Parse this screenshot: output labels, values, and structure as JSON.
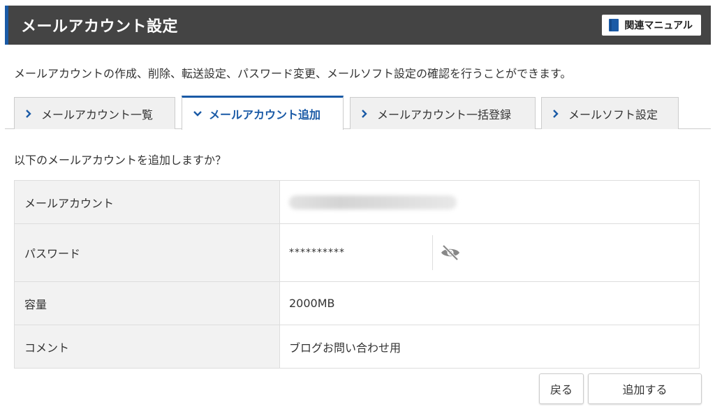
{
  "header": {
    "title": "メールアカウント設定",
    "manual_label": "関連マニュアル",
    "accent_color": "#1a5aa6",
    "background_color": "#444444"
  },
  "description": "メールアカウントの作成、削除、転送設定、パスワード変更、メールソフト設定の確認を行うことができます。",
  "tabs": [
    {
      "label": "メールアカウント一覧",
      "active": false
    },
    {
      "label": "メールアカウント追加",
      "active": true
    },
    {
      "label": "メールアカウント一括登録",
      "active": false
    },
    {
      "label": "メールソフト設定",
      "active": false
    }
  ],
  "confirm_text": "以下のメールアカウントを追加しますか？",
  "details": {
    "account_label": "メールアカウント",
    "account_value": "",
    "password_label": "パスワード",
    "password_value": "**********",
    "password_toggle_icon": "eye-slash-icon",
    "capacity_label": "容量",
    "capacity_value": "2000MB",
    "comment_label": "コメント",
    "comment_value": "ブログお問い合わせ用"
  },
  "buttons": {
    "back_label": "戻る",
    "add_label": "追加する"
  }
}
